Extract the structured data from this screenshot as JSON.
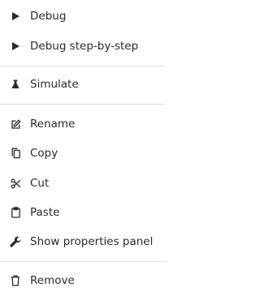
{
  "menu": {
    "items": [
      {
        "label": "Debug",
        "icon": "play-icon"
      },
      {
        "label": "Debug step-by-step",
        "icon": "play-icon"
      },
      {
        "label": "Simulate",
        "icon": "flask-icon"
      },
      {
        "label": "Rename",
        "icon": "edit-icon"
      },
      {
        "label": "Copy",
        "icon": "copy-icon"
      },
      {
        "label": "Cut",
        "icon": "scissors-icon"
      },
      {
        "label": "Paste",
        "icon": "clipboard-icon"
      },
      {
        "label": "Show properties panel",
        "icon": "wrench-icon"
      },
      {
        "label": "Remove",
        "icon": "trash-icon"
      }
    ]
  },
  "colors": {
    "text": "#2b2b2b",
    "icon": "#2b2b2b",
    "divider": "#dcdcdc",
    "background": "#ffffff"
  }
}
